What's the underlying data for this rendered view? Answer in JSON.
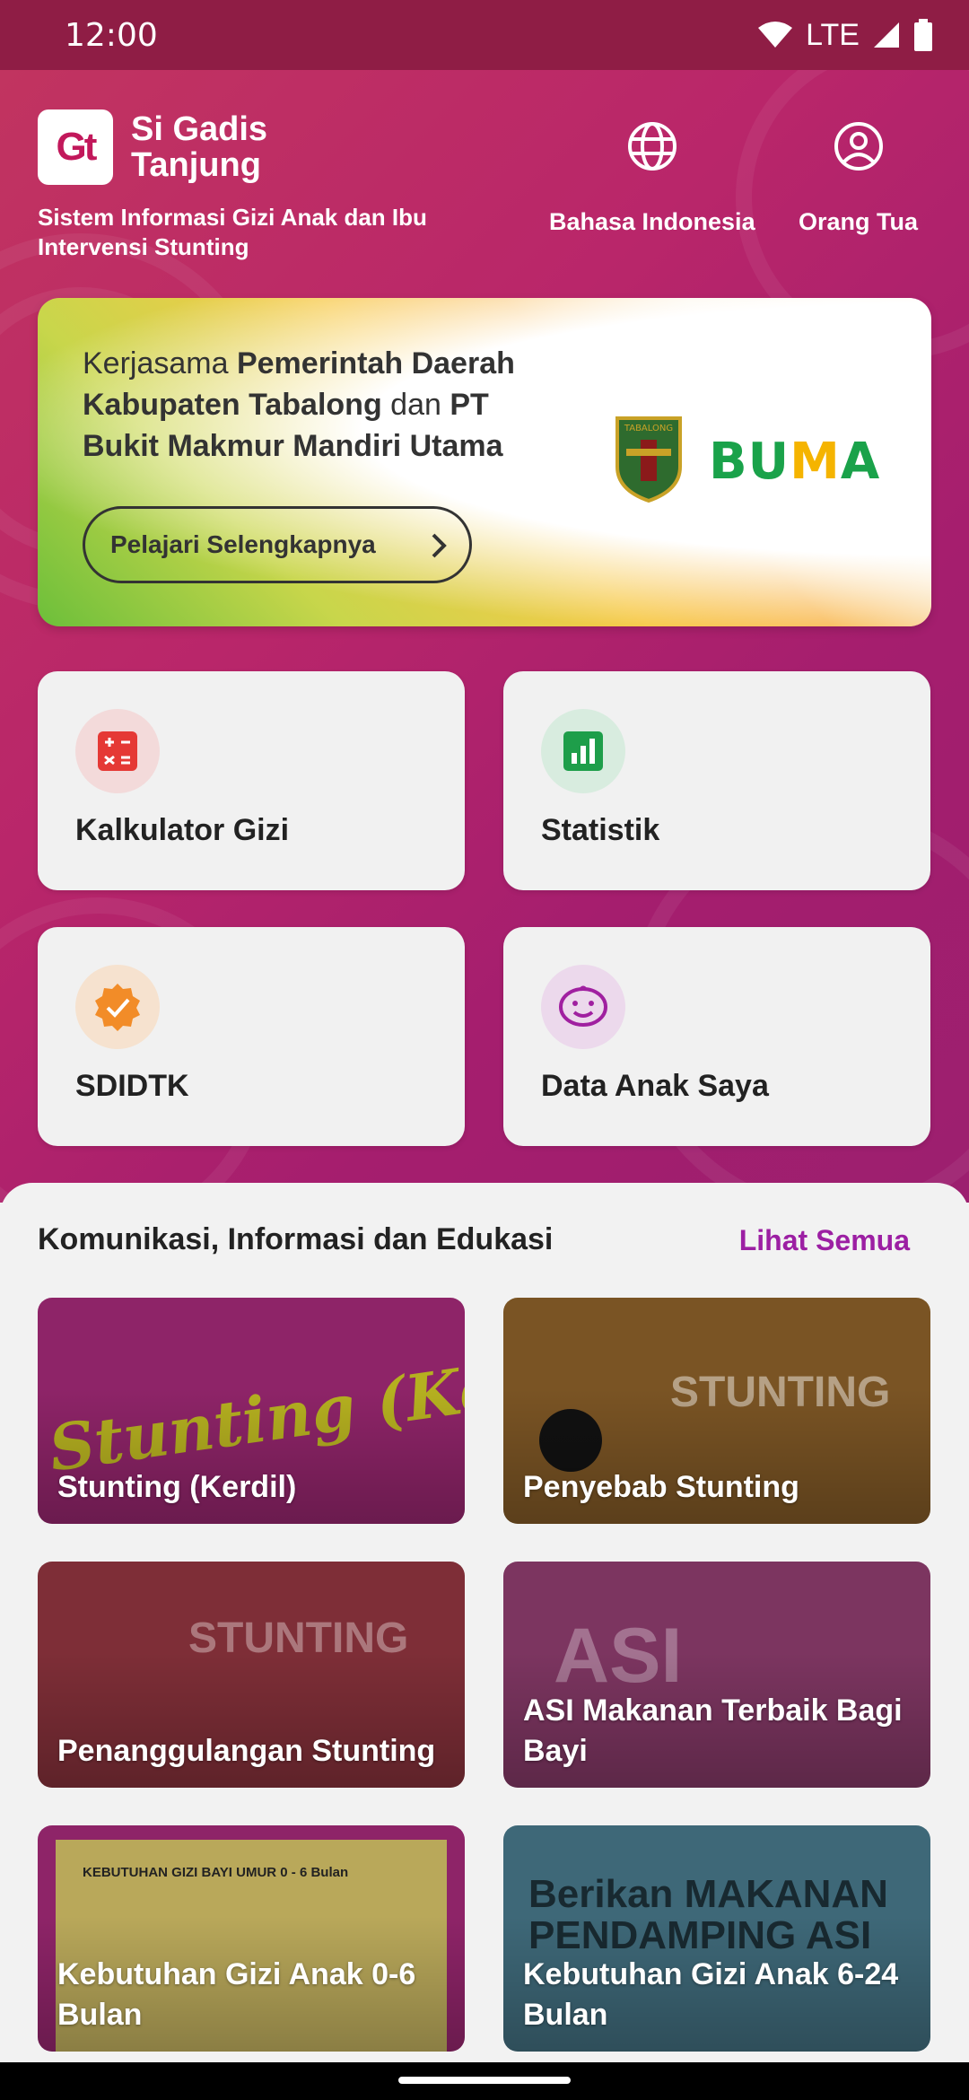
{
  "status_bar": {
    "time": "12:00",
    "network": "LTE",
    "icons": [
      "wifi-icon",
      "signal-icon",
      "battery-icon"
    ]
  },
  "header": {
    "logo_text": "Gt",
    "app_name": "Si Gadis Tanjung",
    "subtitle": "Sistem Informasi Gizi Anak dan Ibu Intervensi Stunting",
    "language_label": "Bahasa Indonesia",
    "profile_label": "Orang Tua"
  },
  "banner": {
    "text_line1_regular": "Kerjasama ",
    "text_line1_bold": "Pemerintah Daerah",
    "text_line2_bold": "Kabupaten Tabalong",
    "text_line2_regular": " dan ",
    "text_line2_bold2": "PT",
    "text_line3_bold": "Bukit Makmur Mandiri Utama",
    "button_label": "Pelajari Selengkapnya",
    "seal_label": "TABALONG",
    "partner_logo_a": "BU",
    "partner_logo_m": "M",
    "partner_logo_b": "A"
  },
  "features": [
    {
      "label": "Kalkulator Gizi",
      "icon": "calculator-icon",
      "color": "#e53935",
      "bg": "#f3dada"
    },
    {
      "label": "Statistik",
      "icon": "bar-chart-icon",
      "color": "#1e9e4a",
      "bg": "#d8ecdf"
    },
    {
      "label": "SDIDTK",
      "icon": "verified-badge-icon",
      "color": "#f28c28",
      "bg": "#f6e2cf"
    },
    {
      "label": "Data Anak Saya",
      "icon": "baby-face-icon",
      "color": "#a020a0",
      "bg": "#ecd9ec"
    }
  ],
  "kie": {
    "title": "Komunikasi, Informasi dan Edukasi",
    "see_all": "Lihat Semua",
    "cards": [
      {
        "title": "Stunting (Kerdil)",
        "bg": "#8e2468",
        "deco": "Stunting (Kerdil)"
      },
      {
        "title": "Penyebab Stunting",
        "bg": "#7a5424",
        "deco": "STUNTING"
      },
      {
        "title": "Penanggulangan Stunting",
        "bg": "#7e2e37",
        "deco": "STUNTING"
      },
      {
        "title": "ASI Makanan Terbaik Bagi Bayi",
        "bg": "#7c3560",
        "deco": "ASI"
      },
      {
        "title": "Kebutuhan Gizi Anak 0-6 Bulan",
        "bg": "#8e2468",
        "deco": "KEBUTUHAN GIZI BAYI UMUR 0 - 6 Bulan"
      },
      {
        "title": "Kebutuhan Gizi Anak 6-24 Bulan",
        "bg": "#3e6878",
        "deco": "Berikan MAKANAN PENDAMPING ASI"
      }
    ]
  },
  "colors": {
    "brand": "#c2185b",
    "accent_link": "#9c1fa3",
    "status_bar": "#8f1d45"
  }
}
